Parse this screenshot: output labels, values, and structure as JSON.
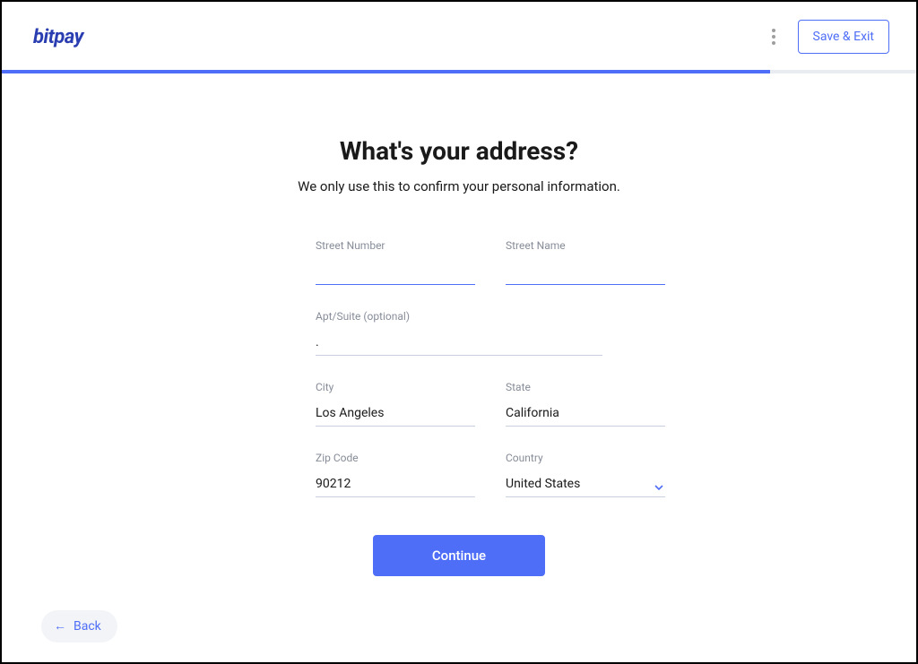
{
  "header": {
    "logo": "bitpay",
    "save_exit_label": "Save & Exit"
  },
  "progress": {
    "percent": 84
  },
  "page": {
    "title": "What's your address?",
    "subtitle": "We only use this to confirm your personal information."
  },
  "fields": {
    "street_number": {
      "label": "Street Number",
      "value": ""
    },
    "street_name": {
      "label": "Street Name",
      "value": ""
    },
    "apt": {
      "label": "Apt/Suite (optional)",
      "value": "."
    },
    "city": {
      "label": "City",
      "value": "Los Angeles"
    },
    "state": {
      "label": "State",
      "value": "California"
    },
    "zip": {
      "label": "Zip Code",
      "value": "90212"
    },
    "country": {
      "label": "Country",
      "value": "United States"
    }
  },
  "buttons": {
    "continue": "Continue",
    "back": "Back"
  }
}
